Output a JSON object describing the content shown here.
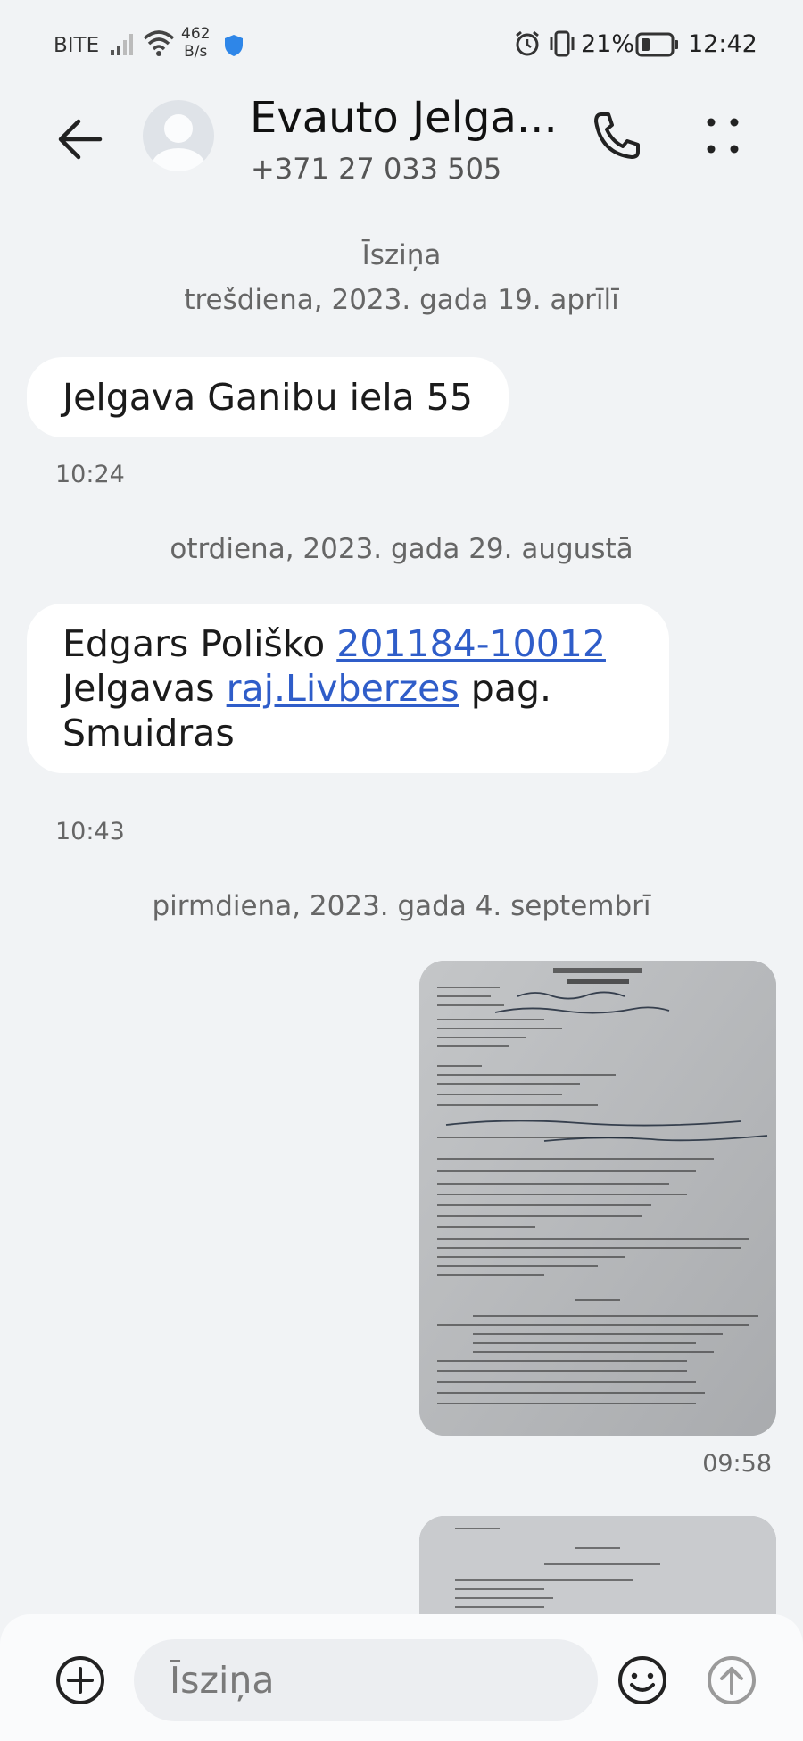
{
  "status_bar": {
    "carrier": "BITE",
    "net_speed_value": "462",
    "net_speed_unit": "B/s",
    "battery_percent": "21%",
    "time": "12:42",
    "icons": [
      "signal-icon",
      "wifi-icon",
      "shield-icon",
      "alarm-icon",
      "vibrate-icon",
      "battery-icon"
    ]
  },
  "header": {
    "contact_name": "Evauto Jelga...",
    "contact_number": "+371 27 033 505",
    "icons": [
      "back-arrow-icon",
      "avatar-icon",
      "phone-icon",
      "more-dots-icon"
    ]
  },
  "conversation": {
    "channel_label": "Īsziņa",
    "sections": [
      {
        "date": "trešdiena, 2023. gada 19. aprīlī",
        "messages": [
          {
            "direction": "incoming",
            "text": "Jelgava Ganibu iela 55",
            "time": "10:24"
          }
        ]
      },
      {
        "date": "otrdiena, 2023. gada 29. augustā",
        "messages": [
          {
            "direction": "incoming",
            "text_part1": "Edgars Poliško ",
            "link1": "201184-10012",
            "text_part2": "Jelgavas ",
            "link2": "raj.Livberzes",
            "text_part3": " pag. Smuidras",
            "time": "10:43"
          }
        ]
      },
      {
        "date": "pirmdiena, 2023. gada 4. septembrī",
        "messages": [
          {
            "direction": "outgoing",
            "type": "image",
            "description": "photo of filled paper form",
            "time": "09:58"
          },
          {
            "direction": "outgoing",
            "type": "image",
            "description": "photo of second form page"
          }
        ]
      }
    ]
  },
  "composer": {
    "placeholder": "Īsziņa",
    "icons": [
      "add-icon",
      "emoji-icon",
      "send-icon"
    ]
  },
  "colors": {
    "background": "#f1f3f5",
    "bubble_incoming": "#ffffff",
    "link": "#2f5dc9",
    "secondary_text": "#666666"
  }
}
